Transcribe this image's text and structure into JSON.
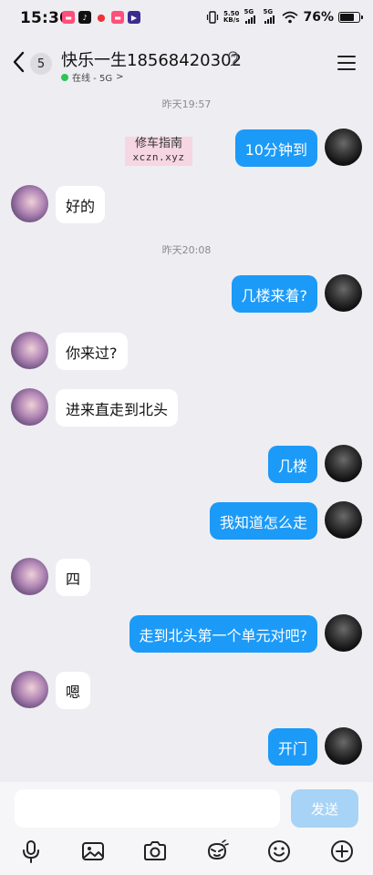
{
  "status_bar": {
    "time": "15:30",
    "net_speed_value": "5.50",
    "net_speed_unit": "KB/s",
    "signal1": "5G",
    "signal2": "5G",
    "battery": "76%"
  },
  "header": {
    "back_badge": "5",
    "contact_name": "快乐一生18568420302",
    "presence": "在线 - 5G",
    "presence_chevron": ">"
  },
  "watermark": {
    "line1": "修车指南",
    "line2": "xczn.xyz"
  },
  "chat": {
    "timestamps": [
      "昨天19:57",
      "昨天20:08"
    ],
    "messages": [
      {
        "side": "mine",
        "text": "10分钟到"
      },
      {
        "side": "theirs",
        "text": "好的"
      },
      {
        "side": "mine",
        "text": "几楼来着?"
      },
      {
        "side": "theirs",
        "text": "你来过?"
      },
      {
        "side": "theirs",
        "text": "进来直走到北头"
      },
      {
        "side": "mine",
        "text": "几楼"
      },
      {
        "side": "mine",
        "text": "我知道怎么走"
      },
      {
        "side": "theirs",
        "text": "四"
      },
      {
        "side": "mine",
        "text": "走到北头第一个单元对吧?"
      },
      {
        "side": "theirs",
        "text": "嗯"
      },
      {
        "side": "mine",
        "text": "开门"
      }
    ]
  },
  "input": {
    "value": "",
    "send_label": "发送"
  },
  "toolbar": [
    "microphone-icon",
    "image-icon",
    "camera-icon",
    "emoji-icon",
    "sticker-icon",
    "plus-icon"
  ],
  "colors": {
    "accent": "#1c9af7",
    "send_disabled": "#a7d3f6",
    "online": "#2dc653",
    "background": "#eeedf2"
  }
}
